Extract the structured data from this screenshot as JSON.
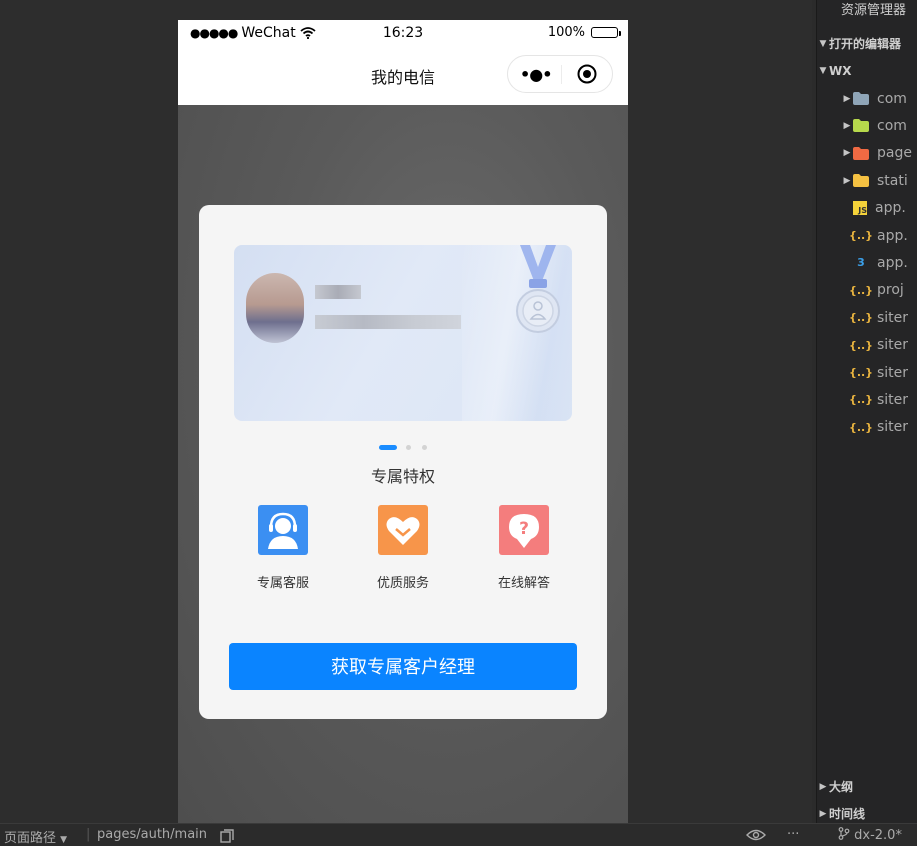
{
  "phone": {
    "status": {
      "carrier_dots": "●●●●●",
      "carrier": "WeChat",
      "time": "16:23",
      "battery": "100%"
    },
    "nav": {
      "title": "我的电信",
      "more": "•●•"
    },
    "dialog": {
      "pager": {
        "count": 3,
        "active": 0
      },
      "section_title": "专属特权",
      "features": [
        {
          "label": "专属客服",
          "icon": "headset-icon",
          "color": "#3b8ff2"
        },
        {
          "label": "优质服务",
          "icon": "heart-icon",
          "color": "#f7954a"
        },
        {
          "label": "在线解答",
          "icon": "question-icon",
          "color": "#f47d7d"
        }
      ],
      "cta_label": "获取专属客户经理"
    }
  },
  "explorer": {
    "title": "资源管理器",
    "open_editors": "打开的编辑器",
    "workspace": "WX",
    "items": [
      {
        "name": "com",
        "icon": "folder-icon",
        "color": "#8fa5b7",
        "arrow": "▶"
      },
      {
        "name": "com",
        "icon": "components-folder-icon",
        "color": "#b7d94c",
        "arrow": "▶"
      },
      {
        "name": "page",
        "icon": "pages-folder-icon",
        "color": "#f06a43",
        "arrow": "▶"
      },
      {
        "name": "stati",
        "icon": "static-folder-icon",
        "color": "#f5c142",
        "arrow": "▶"
      },
      {
        "name": "app.",
        "icon": "js-file-icon",
        "color": "#f5d33a",
        "glyph": "JS"
      },
      {
        "name": "app.",
        "icon": "json-file-icon",
        "color": "#e8b33f",
        "glyph": "{..}"
      },
      {
        "name": "app.",
        "icon": "css-file-icon",
        "color": "#3b9fe8",
        "glyph": "3"
      },
      {
        "name": "proj",
        "icon": "json-file-icon",
        "color": "#e8b33f",
        "glyph": "{..}"
      },
      {
        "name": "siter",
        "icon": "json-file-icon",
        "color": "#e8b33f",
        "glyph": "{..}"
      },
      {
        "name": "siter",
        "icon": "json-file-icon",
        "color": "#e8b33f",
        "glyph": "{..}"
      },
      {
        "name": "siter",
        "icon": "json-file-icon",
        "color": "#e8b33f",
        "glyph": "{..}"
      },
      {
        "name": "siter",
        "icon": "json-file-icon",
        "color": "#e8b33f",
        "glyph": "{..}"
      },
      {
        "name": "siter",
        "icon": "json-file-icon",
        "color": "#e8b33f",
        "glyph": "{..}"
      }
    ],
    "outline": "大纲",
    "timeline": "时间线"
  },
  "bottombar": {
    "page_path_label": "页面路径",
    "path": "pages/auth/main",
    "more": "···",
    "branch": "dx-2.0*"
  }
}
